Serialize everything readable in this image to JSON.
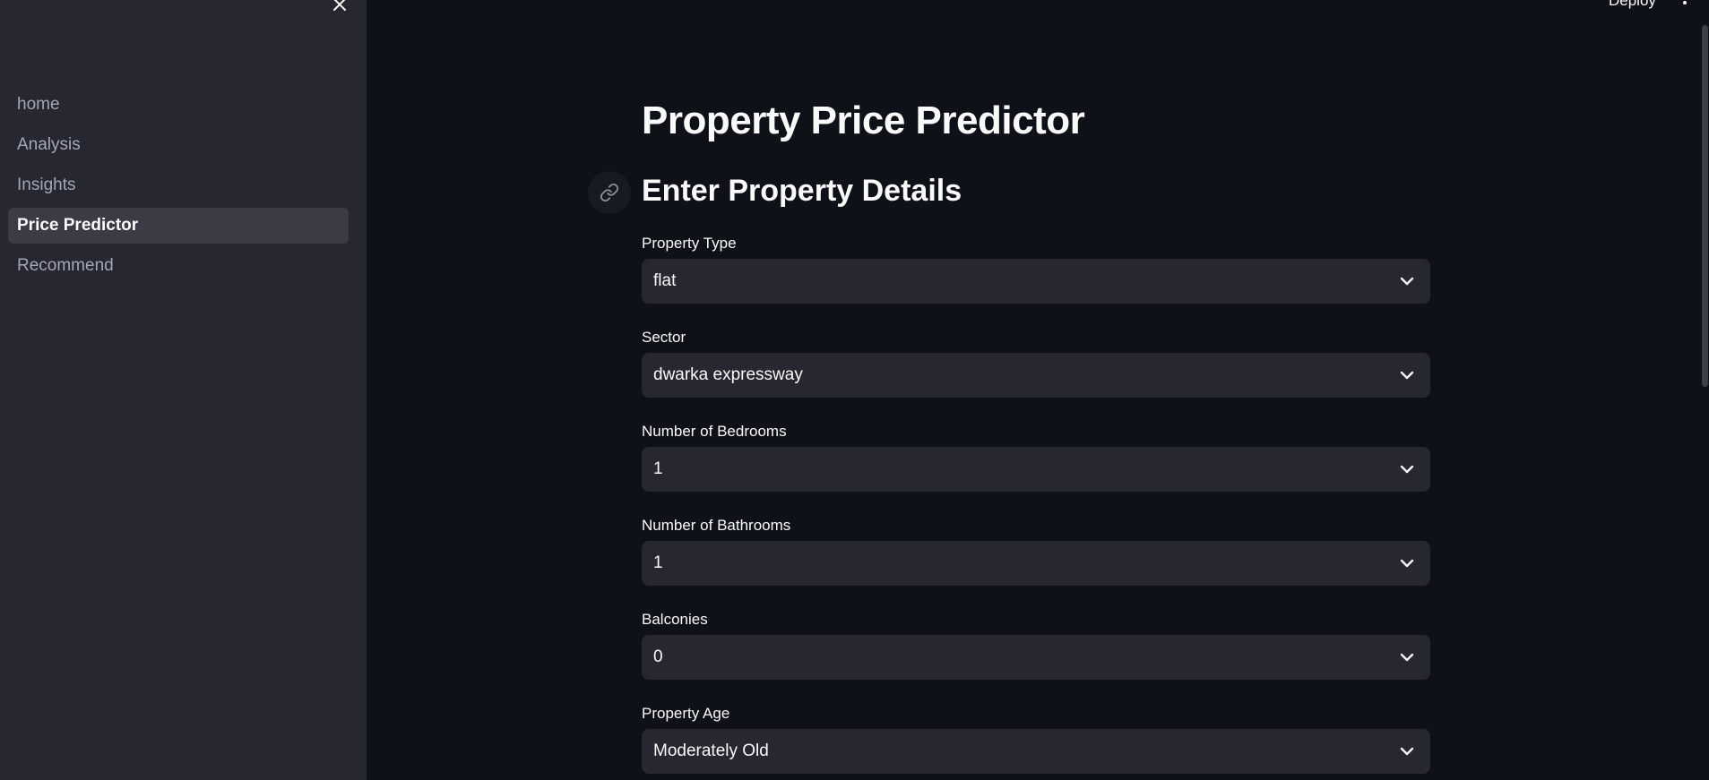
{
  "sidebar": {
    "items": [
      {
        "label": "home"
      },
      {
        "label": "Analysis"
      },
      {
        "label": "Insights"
      },
      {
        "label": "Price Predictor",
        "active": true
      },
      {
        "label": "Recommend"
      }
    ]
  },
  "header": {
    "deploy_label": "Deploy"
  },
  "main": {
    "title": "Property Price Predictor",
    "section_title": "Enter Property Details",
    "fields": [
      {
        "label": "Property Type",
        "value": "flat"
      },
      {
        "label": "Sector",
        "value": "dwarka expressway"
      },
      {
        "label": "Number of Bedrooms",
        "value": "1"
      },
      {
        "label": "Number of Bathrooms",
        "value": "1"
      },
      {
        "label": "Balconies",
        "value": "0"
      },
      {
        "label": "Property Age",
        "value": "Moderately Old"
      }
    ]
  },
  "colors": {
    "background": "#0e1117",
    "sidebar": "#262730",
    "select": "#262730",
    "text": "#fafafa"
  },
  "icons": [
    "close-icon",
    "link-icon",
    "chevron-down-icon",
    "more-vert-icon"
  ]
}
